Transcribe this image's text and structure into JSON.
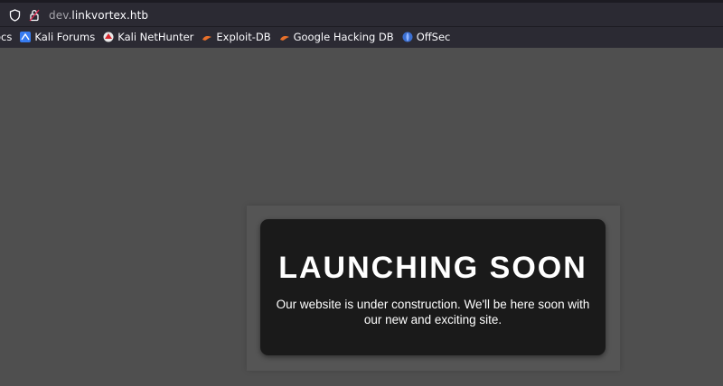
{
  "browser": {
    "url_prefix": "dev.",
    "url_domain": "linkvortex.htb",
    "bookmarks": [
      {
        "label": "ocs",
        "icon": "docs-icon"
      },
      {
        "label": "Kali Forums",
        "icon": "kali-forums-icon"
      },
      {
        "label": "Kali NetHunter",
        "icon": "kali-nethunter-icon"
      },
      {
        "label": "Exploit-DB",
        "icon": "exploit-db-icon"
      },
      {
        "label": "Google Hacking DB",
        "icon": "google-hacking-db-icon"
      },
      {
        "label": "OffSec",
        "icon": "offsec-icon"
      }
    ]
  },
  "page": {
    "title": "LAUNCHING SOON",
    "message": "Our website is under construction. We'll be here soon with our new and exciting site."
  },
  "colors": {
    "page_bg": "#4f4f4f",
    "card_bg": "#1a1a1a",
    "chrome_bg": "#2b2a33"
  }
}
